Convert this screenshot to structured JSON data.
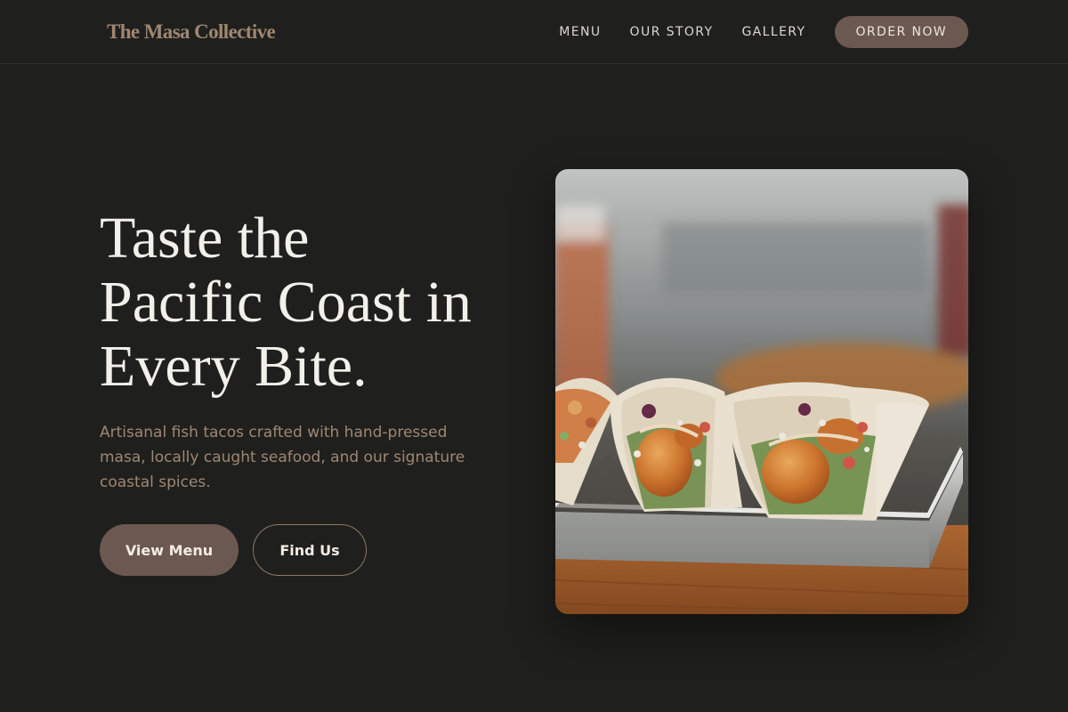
{
  "brand": {
    "name": "The Masa Collective"
  },
  "nav": {
    "links": [
      {
        "label": "MENU"
      },
      {
        "label": "OUR STORY"
      },
      {
        "label": "GALLERY"
      }
    ],
    "cta_label": "ORDER NOW"
  },
  "hero": {
    "title_lines": [
      "Taste the",
      "Pacific Coast in",
      "Every Bite."
    ],
    "subtitle_lines": [
      "Artisanal fish tacos crafted with hand-pressed",
      "masa, locally caught seafood, and our signature",
      "coastal spices."
    ],
    "primary_button": "View Menu",
    "secondary_button": "Find Us",
    "image_icon": "fish-tacos-photo"
  },
  "colors": {
    "background": "#1f201d",
    "accent": "#6b5850",
    "brand": "#a08672",
    "text_light": "#f3f0ea"
  }
}
